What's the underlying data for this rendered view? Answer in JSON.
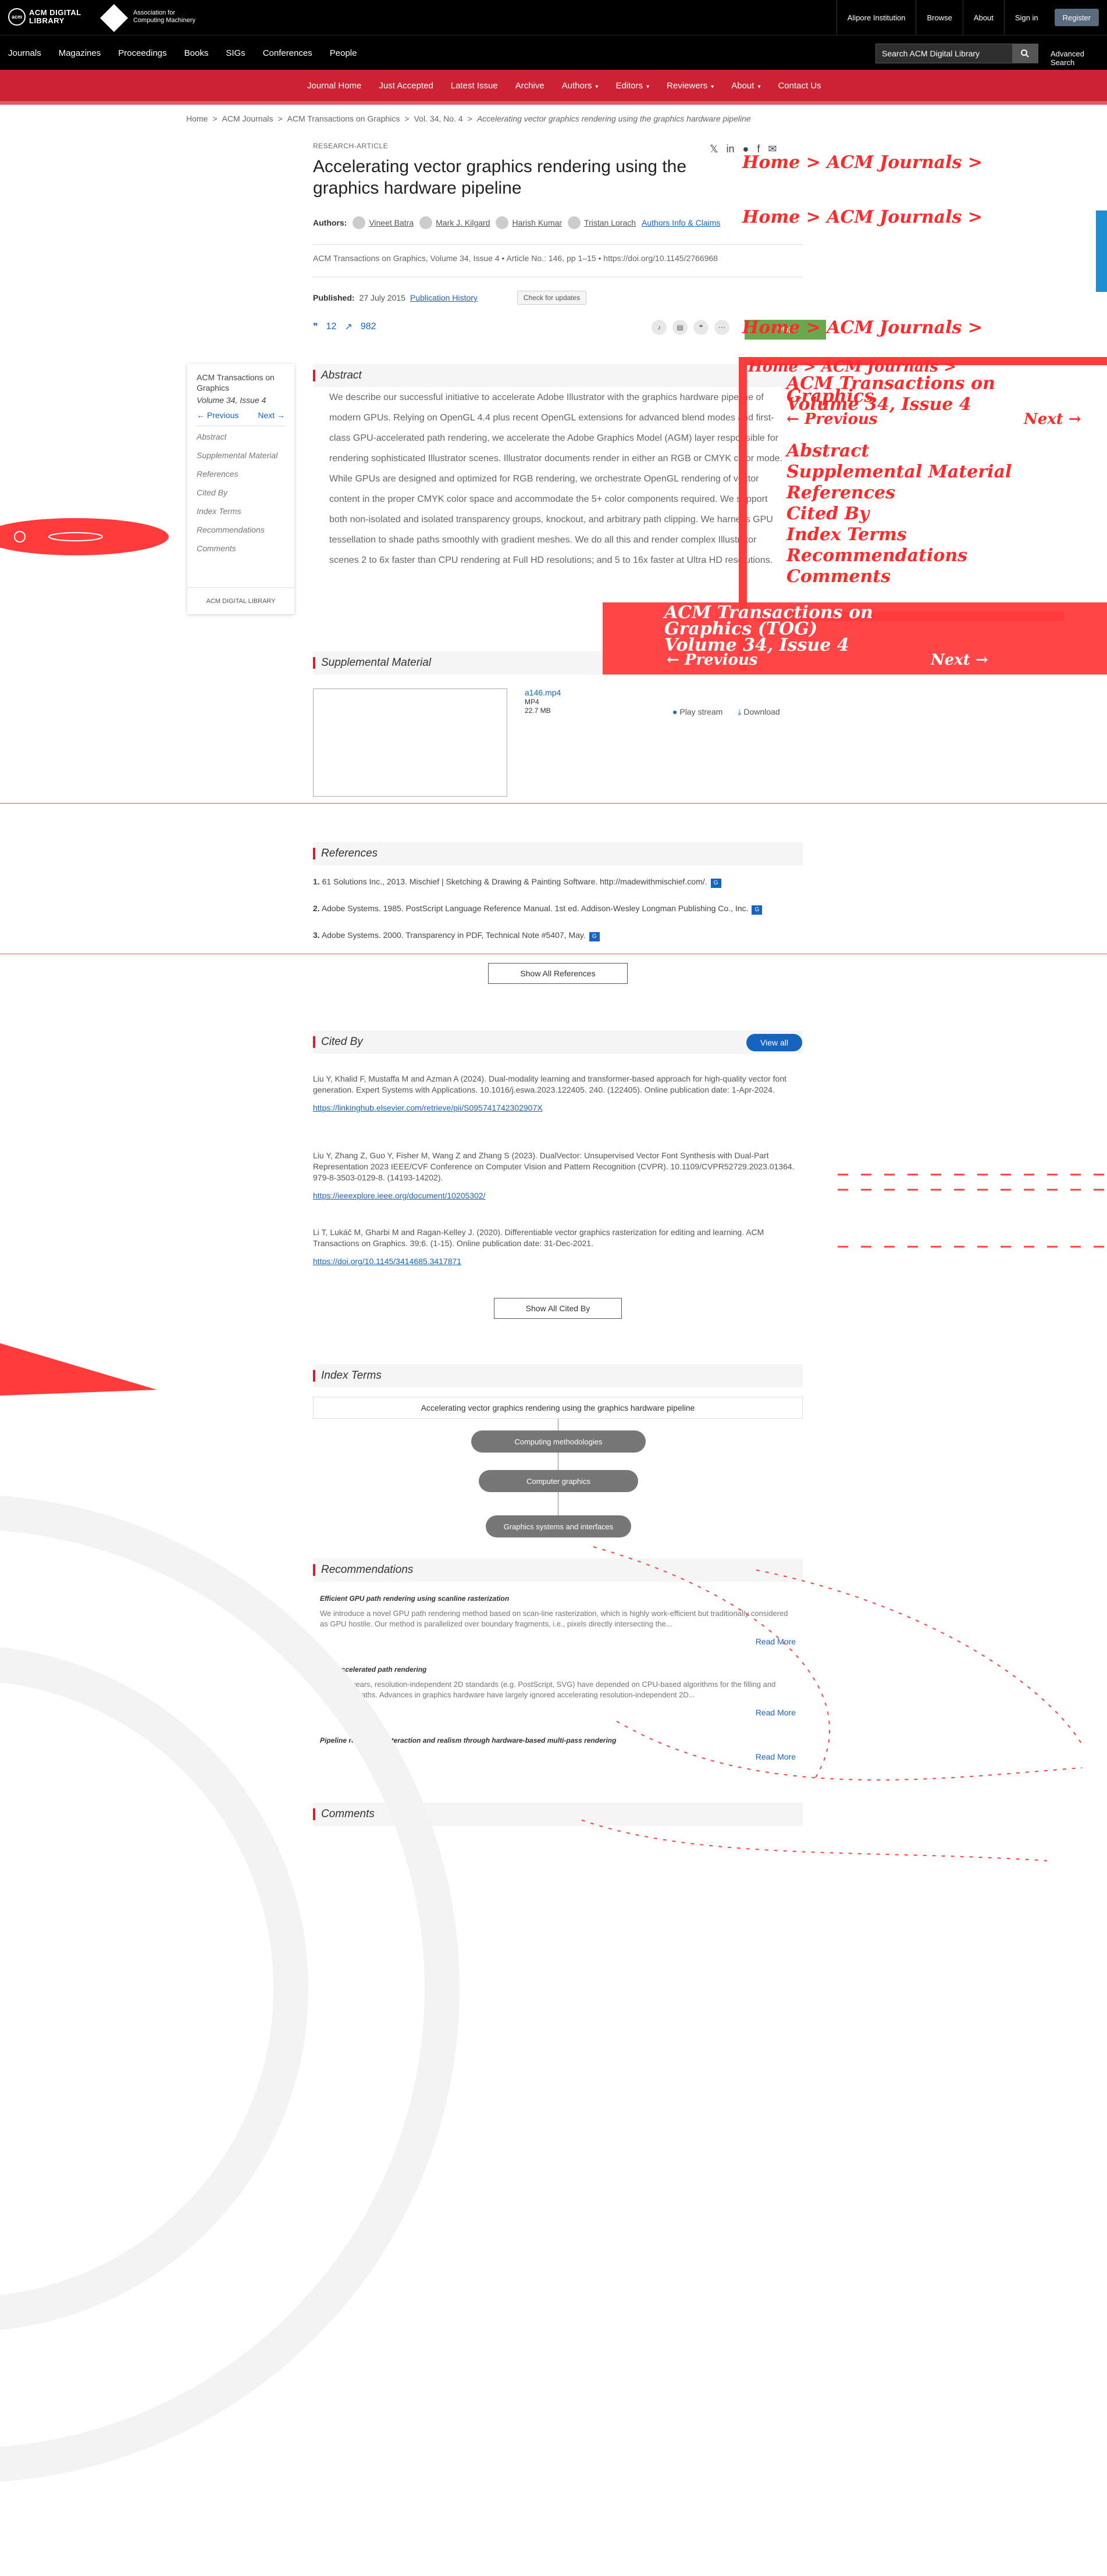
{
  "topbar": {
    "acm_logo": "ACM DIGITAL LIBRARY",
    "acm_badge": "acm",
    "assoc_logo": "Association for Computing Machinery",
    "links": [
      "Alipore Institution",
      "Browse",
      "About",
      "Sign in",
      "Register"
    ]
  },
  "nav": {
    "items": [
      "Journals",
      "Magazines",
      "Proceedings",
      "Books",
      "SIGs",
      "Conferences",
      "People"
    ],
    "search_placeholder": "Search ACM Digital Library",
    "advanced": "Advanced Search"
  },
  "journal_nav": {
    "items": [
      "Journal Home",
      "Just Accepted",
      "Latest Issue",
      "Archive",
      "Authors",
      "Editors",
      "Reviewers",
      "About",
      "Contact Us"
    ]
  },
  "breadcrumb": [
    "Home",
    ">",
    "ACM Journals",
    ">",
    "ACM Transactions on Graphics",
    ">",
    "Vol. 34, No. 4",
    ">",
    "Accelerating vector graphics rendering using the graphics hardware pipeline"
  ],
  "article": {
    "kicker": "RESEARCH-ARTICLE",
    "title": "Accelerating vector graphics rendering using the graphics hardware pipeline",
    "authors_label": "Authors:",
    "authors": [
      "Vineet Batra",
      "Mark J. Kilgard",
      "Harish Kumar",
      "Tristan Lorach"
    ],
    "authors_info": "Authors Info & Claims",
    "citation": "ACM Transactions on Graphics, Volume 34, Issue 4 • Article No.: 146, pp 1–15 • https://doi.org/10.1145/2766968",
    "published_label": "Published:",
    "published_date": "27 July 2015",
    "pub_history": "Publication History",
    "check_updates": "Check for updates",
    "citations": "12",
    "downloads": "982",
    "pdf_label": "PDF"
  },
  "sidebar": {
    "journal": "ACM Transactions on Graphics",
    "volume": "Volume 34, Issue 4",
    "prev": "← Previous",
    "next": "Next →",
    "items": [
      "Abstract",
      "Supplemental Material",
      "References",
      "Cited By",
      "Index Terms",
      "Recommendations",
      "Comments"
    ],
    "footer": "ACM DIGITAL LIBRARY"
  },
  "abstract": {
    "heading": "Abstract",
    "text": "We describe our successful initiative to accelerate Adobe Illustrator with the graphics hardware pipeline of modern GPUs. Relying on OpenGL 4.4 plus recent OpenGL extensions for advanced blend modes and first-class GPU-accelerated path rendering, we accelerate the Adobe Graphics Model (AGM) layer responsible for rendering sophisticated Illustrator scenes. Illustrator documents render in either an RGB or CMYK color mode. While GPUs are designed and optimized for RGB rendering, we orchestrate OpenGL rendering of vector content in the proper CMYK color space and accommodate the 5+ color components required. We support both non-isolated and isolated transparency groups, knockout, and arbitrary path clipping. We harness GPU tessellation to shade paths smoothly with gradient meshes. We do all this and render complex Illustrator scenes 2 to 6x faster than CPU rendering at Full HD resolutions; and 5 to 16x faster at Ultra HD resolutions."
  },
  "supplemental": {
    "heading": "Supplemental Material",
    "file": "a146.mp4",
    "type": "MP4",
    "size": "22.7 MB",
    "play": "Play stream",
    "download": "Download"
  },
  "references": {
    "heading": "References",
    "items": [
      {
        "n": "1.",
        "text": "61 Solutions Inc., 2013. Mischief | Sketching & Drawing & Painting Software. http://madewithmischief.com/."
      },
      {
        "n": "2.",
        "text": "Adobe Systems. 1985. PostScript Language Reference Manual. 1st ed. Addison-Wesley Longman Publishing Co., Inc."
      },
      {
        "n": "3.",
        "text": "Adobe Systems. 2000. Transparency in PDF, Technical Note #5407, May."
      }
    ],
    "show_all": "Show All References"
  },
  "cited_by": {
    "heading": "Cited By",
    "view_all": "View all",
    "items": [
      {
        "text": "Liu Y, Khalid F, Mustaffa M and Azman A (2024). Dual-modality learning and transformer-based approach for high-quality vector font generation. Expert Systems with Applications. 10.1016/j.eswa.2023.122405. 240. (122405). Online publication date: 1-Apr-2024.",
        "link": "https://linkinghub.elsevier.com/retrieve/pii/S095741742302907X"
      },
      {
        "text": "Liu Y, Zhang Z, Guo Y, Fisher M, Wang Z and Zhang S (2023). DualVector: Unsupervised Vector Font Synthesis with Dual-Part Representation 2023 IEEE/CVF Conference on Computer Vision and Pattern Recognition (CVPR). 10.1109/CVPR52729.2023.01364. 979-8-3503-0129-8. (14193-14202).",
        "link": "https://ieeexplore.ieee.org/document/10205302/"
      },
      {
        "text": "Li T, Lukáč M, Gharbi M and Ragan-Kelley J. (2020). Differentiable vector graphics rasterization for editing and learning. ACM Transactions on Graphics. 39:6. (1-15). Online publication date: 31-Dec-2021.",
        "link": "https://doi.org/10.1145/3414685.3417871"
      }
    ],
    "show_all": "Show All Cited By"
  },
  "index_terms": {
    "heading": "Index Terms",
    "root": "Accelerating vector graphics rendering using the graphics hardware pipeline",
    "nodes": [
      "Computing methodologies",
      "Computer graphics",
      "Graphics systems and interfaces"
    ]
  },
  "recommendations": {
    "heading": "Recommendations",
    "items": [
      {
        "title": "Efficient GPU path rendering using scanline rasterization",
        "text": "We introduce a novel GPU path rendering method based on scan-line rasterization, which is highly work-efficient but traditionally considered as GPU hostile. Our method is parallelized over boundary fragments, i.e., pixels directly intersecting the...",
        "more": "Read More"
      },
      {
        "title": "GPU-accelerated path rendering",
        "text": "For thirty years, resolution-independent 2D standards (e.g. PostScript, SVG) have depended on CPU-based algorithms for the filling and stroking of paths. Advances in graphics hardware have largely ignored accelerating resolution-independent 2D...",
        "more": "Read More"
      },
      {
        "title": "Pipeline rendering: interaction and realism through hardware-based multi-pass rendering",
        "text": "",
        "more": "Read More"
      }
    ]
  },
  "comments": {
    "heading": "Comments"
  },
  "overlay": {
    "lines": [
      "Home > ACM Journals >",
      "Home > ACM Journals >",
      "Home > ACM Journals >",
      "Home > ACM Journals >",
      "ACM Transactions on",
      "Graphics",
      "Volume 34, Issue 4",
      "← Previous",
      "Next →",
      "Abstract",
      "Supplemental Material",
      "References",
      "Cited By",
      "Index Terms",
      "Recommendations",
      "Comments",
      "ACM Transactions on",
      "Graphics (TOG)",
      "Volume 34, Issue 4",
      "← Previous",
      "Next →"
    ]
  },
  "colors": {
    "accent": "#cc2233",
    "link": "#1565c0",
    "overlay": "#ff2a2a"
  }
}
